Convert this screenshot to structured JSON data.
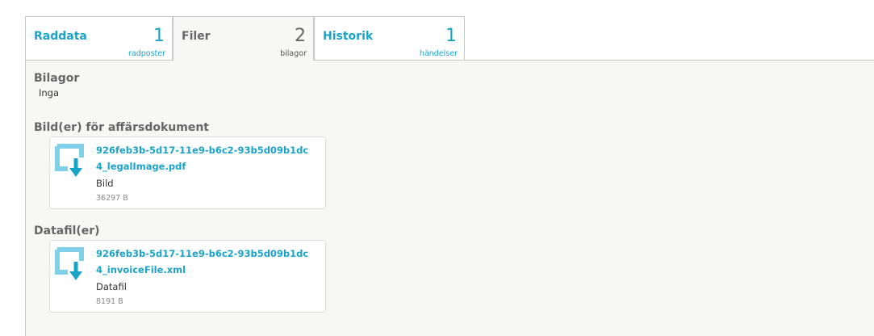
{
  "tabs": [
    {
      "label": "Raddata",
      "count": "1",
      "unit": "radposter",
      "active": false
    },
    {
      "label": "Filer",
      "count": "2",
      "unit": "bilagor",
      "active": true
    },
    {
      "label": "Historik",
      "count": "1",
      "unit": "händelser",
      "active": false
    }
  ],
  "attachments": {
    "title": "Bilagor",
    "empty_text": "Inga"
  },
  "images": {
    "title": "Bild(er) för affärsdokument",
    "files": [
      {
        "name": "926feb3b-5d17-11e9-b6c2-93b5d09b1dc4_legalImage.pdf",
        "type": "Bild",
        "size": "36297 B",
        "icon": "file-download-icon"
      }
    ]
  },
  "datafiles": {
    "title": "Datafil(er)",
    "files": [
      {
        "name": "926feb3b-5d17-11e9-b6c2-93b5d09b1dc4_invoiceFile.xml",
        "type": "Datafil",
        "size": "8191 B",
        "icon": "file-download-icon"
      }
    ]
  },
  "colors": {
    "accent": "#1aa3c9",
    "icon": "#7fd0e8",
    "panel_bg": "#f7f7f6",
    "muted_text": "#666666"
  }
}
